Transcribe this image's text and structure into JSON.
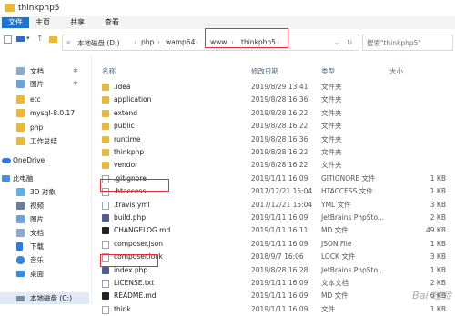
{
  "window": {
    "title": "thinkphp5"
  },
  "ribbon": {
    "tabs": [
      "文件",
      "主页",
      "共享",
      "查看"
    ]
  },
  "address": {
    "crumbs": [
      "本地磁盘 (D:)",
      "php",
      "wamp64",
      "www",
      "thinkphp5"
    ],
    "search_placeholder": "搜索\"thinkphp5\""
  },
  "sidebar": {
    "items": [
      {
        "label": "文档",
        "pinned": true
      },
      {
        "label": "图片",
        "pinned": true
      },
      {
        "label": "etc"
      },
      {
        "label": "mysql-8.0.17"
      },
      {
        "label": "php"
      },
      {
        "label": "工作总结"
      },
      {
        "label": "OneDrive"
      },
      {
        "label": "此电脑"
      },
      {
        "label": "3D 对象"
      },
      {
        "label": "视频"
      },
      {
        "label": "图片"
      },
      {
        "label": "文档"
      },
      {
        "label": "下载"
      },
      {
        "label": "音乐"
      },
      {
        "label": "桌面"
      },
      {
        "label": "本地磁盘 (C:)"
      }
    ]
  },
  "columns": {
    "name": "名称",
    "date": "修改日期",
    "type": "类型",
    "size": "大小"
  },
  "files": [
    {
      "name": ".idea",
      "date": "2019/8/29 13:41",
      "type": "文件夹",
      "size": "",
      "kind": "folder"
    },
    {
      "name": "application",
      "date": "2019/8/28 16:36",
      "type": "文件夹",
      "size": "",
      "kind": "folder"
    },
    {
      "name": "extend",
      "date": "2019/8/28 16:22",
      "type": "文件夹",
      "size": "",
      "kind": "folder"
    },
    {
      "name": "public",
      "date": "2019/8/28 16:22",
      "type": "文件夹",
      "size": "",
      "kind": "folder"
    },
    {
      "name": "runtime",
      "date": "2019/8/28 16:36",
      "type": "文件夹",
      "size": "",
      "kind": "folder"
    },
    {
      "name": "thinkphp",
      "date": "2019/8/28 16:22",
      "type": "文件夹",
      "size": "",
      "kind": "folder"
    },
    {
      "name": "vendor",
      "date": "2019/8/28 16:22",
      "type": "文件夹",
      "size": "",
      "kind": "folder"
    },
    {
      "name": ".gitignore",
      "date": "2019/1/11 16:09",
      "type": "GITIGNORE 文件",
      "size": "1 KB",
      "kind": "file"
    },
    {
      "name": ".htaccess",
      "date": "2017/12/21 15:04",
      "type": "HTACCESS 文件",
      "size": "1 KB",
      "kind": "file"
    },
    {
      "name": ".travis.yml",
      "date": "2017/12/21 15:04",
      "type": "YML 文件",
      "size": "3 KB",
      "kind": "file"
    },
    {
      "name": "build.php",
      "date": "2019/1/11 16:09",
      "type": "JetBrains PhpSto...",
      "size": "2 KB",
      "kind": "php"
    },
    {
      "name": "CHANGELOG.md",
      "date": "2019/1/11 16:11",
      "type": "MD 文件",
      "size": "49 KB",
      "kind": "md"
    },
    {
      "name": "composer.json",
      "date": "2019/1/11 16:09",
      "type": "JSON File",
      "size": "1 KB",
      "kind": "file"
    },
    {
      "name": "composer.lock",
      "date": "2018/9/7 16:06",
      "type": "LOCK 文件",
      "size": "3 KB",
      "kind": "file"
    },
    {
      "name": "index.php",
      "date": "2019/8/28 16:28",
      "type": "JetBrains PhpSto...",
      "size": "1 KB",
      "kind": "php"
    },
    {
      "name": "LICENSE.txt",
      "date": "2019/1/11 16:09",
      "type": "文本文档",
      "size": "2 KB",
      "kind": "file"
    },
    {
      "name": "README.md",
      "date": "2019/1/11 16:09",
      "type": "MD 文件",
      "size": "6 KB",
      "kind": "md"
    },
    {
      "name": "think",
      "date": "2019/1/11 16:09",
      "type": "文件",
      "size": "1 KB",
      "kind": "file"
    }
  ],
  "watermark": "Bai 经验"
}
